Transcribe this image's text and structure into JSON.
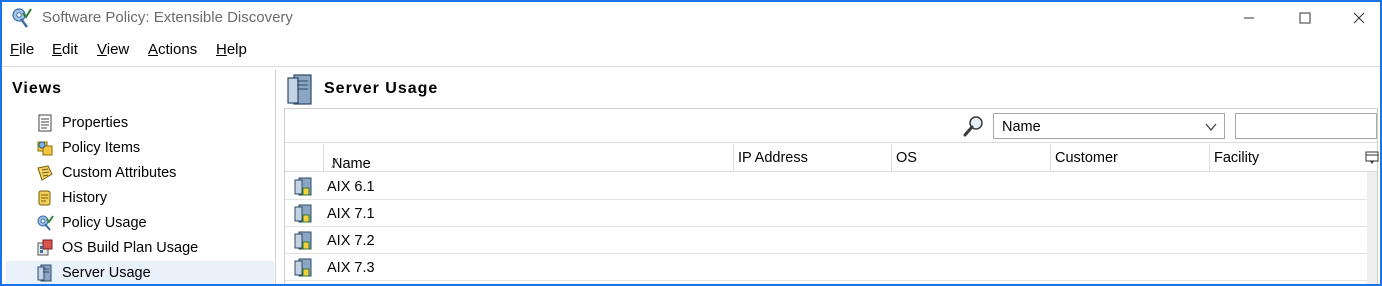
{
  "window": {
    "title": "Software Policy: Extensible Discovery",
    "accent_color": "#1a73e8"
  },
  "menu": [
    {
      "label": "File",
      "mnemonic": "F",
      "rest": "ile"
    },
    {
      "label": "Edit",
      "mnemonic": "E",
      "rest": "dit"
    },
    {
      "label": "View",
      "mnemonic": "V",
      "rest": "iew"
    },
    {
      "label": "Actions",
      "mnemonic": "A",
      "rest": "ctions"
    },
    {
      "label": "Help",
      "mnemonic": "H",
      "rest": "elp"
    }
  ],
  "views": {
    "title": "Views",
    "items": [
      {
        "label": "Properties",
        "icon": "properties-icon"
      },
      {
        "label": "Policy Items",
        "icon": "policy-items-icon"
      },
      {
        "label": "Custom Attributes",
        "icon": "custom-attributes-icon"
      },
      {
        "label": "History",
        "icon": "history-icon"
      },
      {
        "label": "Policy Usage",
        "icon": "policy-usage-icon"
      },
      {
        "label": "OS Build Plan Usage",
        "icon": "os-build-plan-icon"
      },
      {
        "label": "Server Usage",
        "icon": "server-usage-icon",
        "selected": true
      }
    ]
  },
  "panel": {
    "title": "Server Usage",
    "search": {
      "field_selected": "Name",
      "value": ""
    },
    "columns": [
      {
        "label": "Name",
        "sorted": "ascending"
      },
      {
        "label": "IP Address"
      },
      {
        "label": "OS"
      },
      {
        "label": "Customer"
      },
      {
        "label": "Facility"
      }
    ],
    "rows": [
      {
        "name": "AIX 6.1"
      },
      {
        "name": "AIX 7.1"
      },
      {
        "name": "AIX 7.2"
      },
      {
        "name": "AIX 7.3"
      }
    ]
  }
}
